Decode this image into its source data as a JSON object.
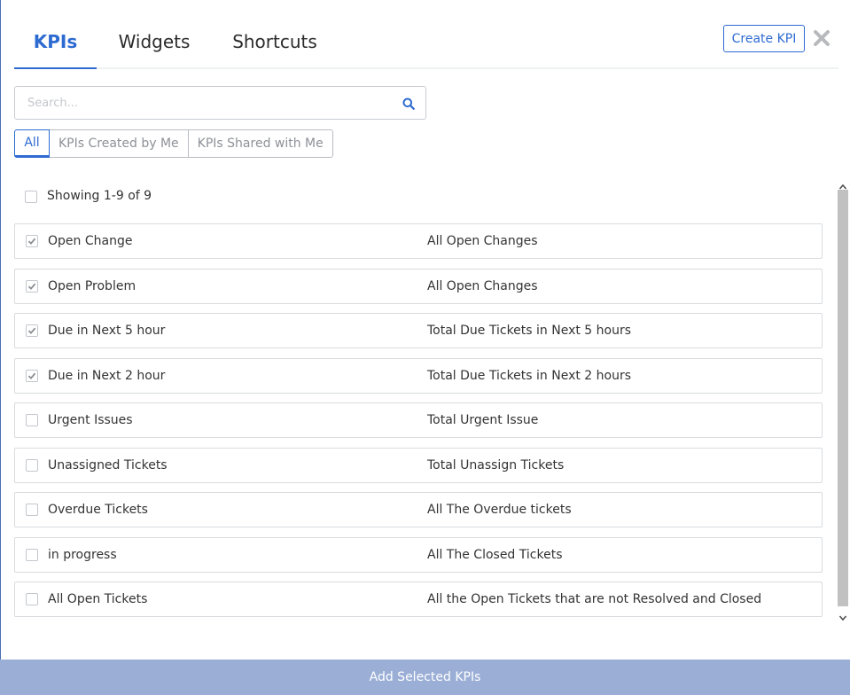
{
  "tabs": [
    {
      "label": "KPIs",
      "active": true
    },
    {
      "label": "Widgets",
      "active": false
    },
    {
      "label": "Shortcuts",
      "active": false
    }
  ],
  "create_kpi_label": "Create KPI",
  "search": {
    "placeholder": "Search...",
    "value": ""
  },
  "filters": [
    {
      "label": "All",
      "active": true
    },
    {
      "label": "KPIs Created by Me",
      "active": false
    },
    {
      "label": "KPIs Shared with Me",
      "active": false
    }
  ],
  "showing_text": "Showing 1-9 of 9",
  "select_all_checked": false,
  "kpis": [
    {
      "name": "Open Change",
      "description": "All Open Changes",
      "checked": true
    },
    {
      "name": "Open Problem",
      "description": "All Open Changes",
      "checked": true
    },
    {
      "name": "Due in Next 5 hour",
      "description": "Total Due Tickets in Next 5 hours",
      "checked": true
    },
    {
      "name": "Due in Next 2 hour",
      "description": "Total Due Tickets in Next 2 hours",
      "checked": true
    },
    {
      "name": "Urgent Issues",
      "description": "Total Urgent Issue",
      "checked": false
    },
    {
      "name": "Unassigned Tickets",
      "description": "Total Unassign Tickets",
      "checked": false
    },
    {
      "name": "Overdue Tickets",
      "description": "All The Overdue tickets",
      "checked": false
    },
    {
      "name": "in progress",
      "description": "All The Closed Tickets",
      "checked": false
    },
    {
      "name": "All Open Tickets",
      "description": "All the Open Tickets that are not Resolved and Closed",
      "checked": false
    }
  ],
  "footer_button_label": "Add Selected KPIs",
  "colors": {
    "accent": "#2e6bd1",
    "footer": "#9aaed6",
    "border": "#d9dbde"
  },
  "icons": {
    "close": "close-icon",
    "search": "search-icon",
    "check": "checkmark-icon"
  }
}
